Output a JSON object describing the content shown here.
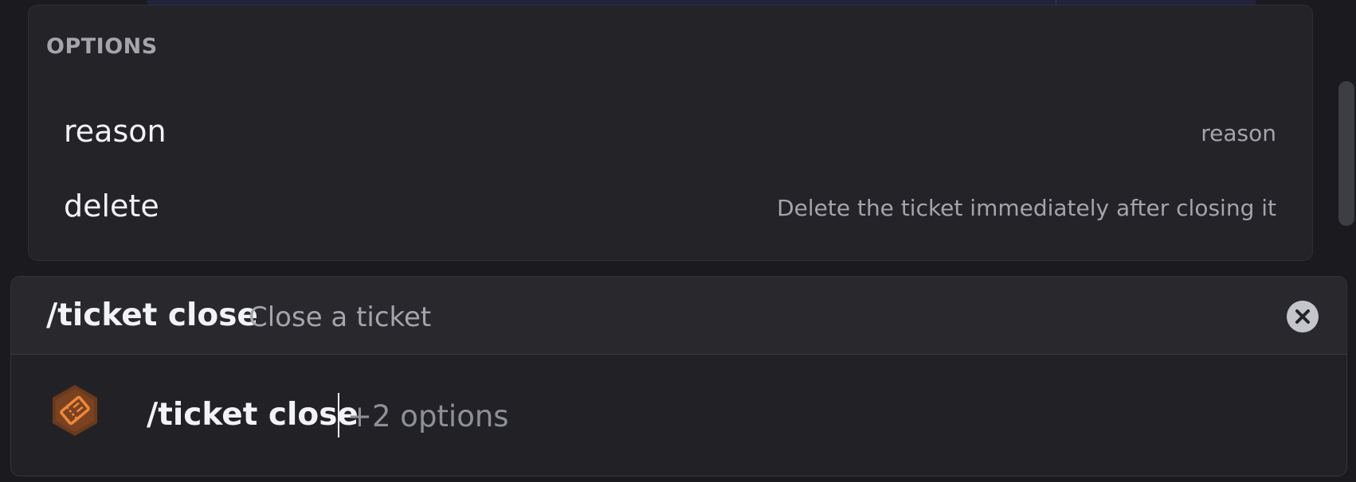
{
  "options_panel": {
    "heading": "OPTIONS",
    "items": [
      {
        "name": "reason",
        "description": "reason"
      },
      {
        "name": "delete",
        "description": "Delete the ticket immediately after closing it"
      }
    ]
  },
  "command_header": {
    "name": "/ticket close",
    "description": "Close a ticket",
    "close_icon": "close-icon"
  },
  "input": {
    "app_icon": "ticket-icon",
    "value": "/ticket close",
    "hint": "+2 options"
  },
  "colors": {
    "background": "#1b1b1f",
    "panel": "#232328",
    "accent_orange": "#f0883a",
    "text_primary": "#f2f3f5",
    "text_muted": "#a3a5ab"
  }
}
